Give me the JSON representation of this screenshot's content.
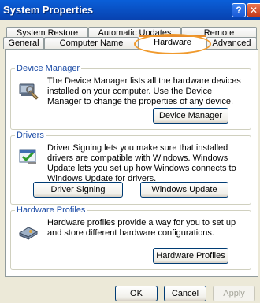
{
  "window": {
    "title": "System Properties",
    "help_label": "?",
    "close_label": "✕"
  },
  "tabs": {
    "back": [
      "System Restore",
      "Automatic Updates",
      "Remote"
    ],
    "front": [
      "General",
      "Computer Name",
      "Hardware",
      "Advanced"
    ],
    "active": "Hardware"
  },
  "device_manager": {
    "label": "Device Manager",
    "text": "The Device Manager lists all the hardware devices installed on your computer. Use the Device Manager to change the properties of any device.",
    "button": "Device Manager",
    "icon": "device-manager-icon"
  },
  "drivers": {
    "label": "Drivers",
    "text": "Driver Signing lets you make sure that installed drivers are compatible with Windows. Windows Update lets you set up how Windows connects to Windows Update for drivers.",
    "driver_signing_button": "Driver Signing",
    "windows_update_button": "Windows Update",
    "icon": "driver-signing-icon"
  },
  "hardware_profiles": {
    "label": "Hardware Profiles",
    "text": "Hardware profiles provide a way for you to set up and store different hardware configurations.",
    "button": "Hardware Profiles",
    "icon": "hardware-profiles-icon"
  },
  "footer": {
    "ok": "OK",
    "cancel": "Cancel",
    "apply": "Apply"
  },
  "colors": {
    "titlebar": "#0a5fd8",
    "group_label": "#1c4ca6",
    "highlight": "#f09a2d",
    "dialog_bg": "#ece9d8"
  }
}
